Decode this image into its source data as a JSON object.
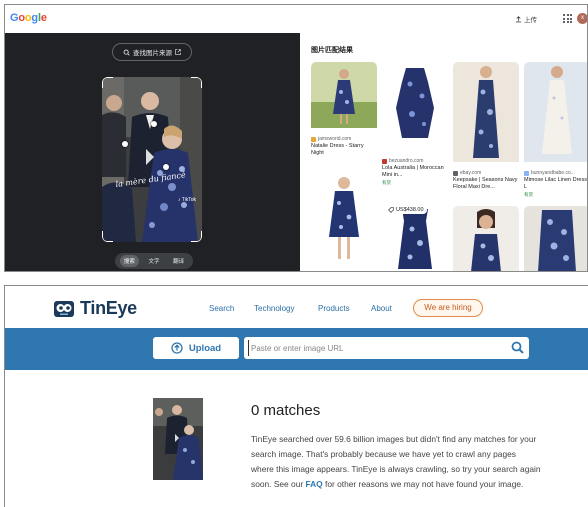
{
  "google": {
    "logo": [
      "G",
      "o",
      "o",
      "g",
      "l",
      "e"
    ],
    "logo_colors": [
      "#4285F4",
      "#EA4335",
      "#FBBC05",
      "#4285F4",
      "#34A853",
      "#EA4335"
    ],
    "upload_label": "上传",
    "avatar_letter": "x",
    "find_source_label": "查找图片来源",
    "modes": [
      "搜索",
      "文字",
      "翻译"
    ],
    "active_mode": "搜索",
    "results_title": "图片匹配结果",
    "results": [
      {
        "source": "jamsworid.com",
        "title": "Natalie Dress - Starry Night",
        "stock": ""
      },
      {
        "source": "bezuandro.com",
        "title": "Lola Australia | Moroccan Mini in...",
        "stock": "有货"
      },
      {
        "source": "ebay.com",
        "title": "Keepsake | Seasons Navy Floral Maxi Dre...",
        "stock": ""
      },
      {
        "source": "bunnyandbabe.co...",
        "title": "Mimose Lilac Linen Dress L",
        "stock": "有货"
      }
    ],
    "price_badge": "US$438.00",
    "accent": "#1a73e8"
  },
  "tineye": {
    "brand": "TinEye",
    "nav": [
      "Search",
      "Technology",
      "Products",
      "About"
    ],
    "hiring": "We are hiring",
    "upload_label": "Upload",
    "search_placeholder": "Paste or enter image URL",
    "matches_heading": "0 matches",
    "message_part1": "TinEye searched over 59.6 billion images but didn't find any matches for your search image. That's probably because we have yet to crawl any pages where this image appears. TinEye is always crawling, so try your search again soon. See our ",
    "faq_link": "FAQ",
    "message_part2": " for other reasons we may not have found your image.",
    "brand_color": "#2f77b1",
    "hiring_color": "#e5894f"
  }
}
